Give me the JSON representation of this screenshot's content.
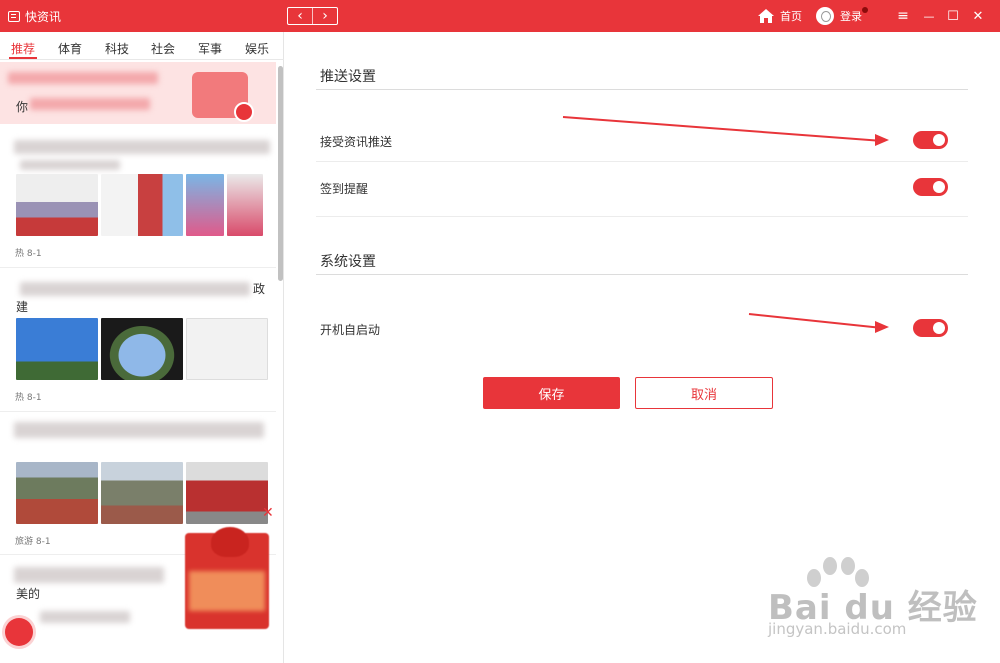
{
  "titlebar": {
    "app_name": "快资讯",
    "back_arrow": "‹",
    "forward_arrow": "›",
    "home_label": "首页",
    "login_label": "登录",
    "menu_icon": "≡",
    "minimize_icon": "—",
    "maximize_icon": "☐",
    "close_icon": "✕"
  },
  "left_panel": {
    "tabs": [
      {
        "label": "推荐",
        "active": true
      },
      {
        "label": "体育",
        "active": false
      },
      {
        "label": "科技",
        "active": false
      },
      {
        "label": "社会",
        "active": false
      },
      {
        "label": "军事",
        "active": false
      },
      {
        "label": "娱乐",
        "active": false
      }
    ],
    "banner_char": "你",
    "news": [
      {
        "meta": "热  8-1"
      },
      {
        "title_fragment": "政",
        "title_fragment2": "建",
        "meta": "热  8-1"
      },
      {
        "meta": "旅游  8-1"
      },
      {
        "title_fragment": "美的"
      }
    ],
    "ad_close_icon": "✕"
  },
  "settings": {
    "push_section_title": "推送设置",
    "push_rows": [
      {
        "label": "接受资讯推送",
        "on": true
      },
      {
        "label": "签到提醒",
        "on": true
      }
    ],
    "system_section_title": "系统设置",
    "system_rows": [
      {
        "label": "开机自启动",
        "on": true
      }
    ],
    "save_label": "保存",
    "cancel_label": "取消"
  },
  "watermark": {
    "brand": "Bai du 经验",
    "url": "jingyan.baidu.com"
  },
  "colors": {
    "accent": "#e8353a",
    "banner_bg": "#fde3e3"
  }
}
